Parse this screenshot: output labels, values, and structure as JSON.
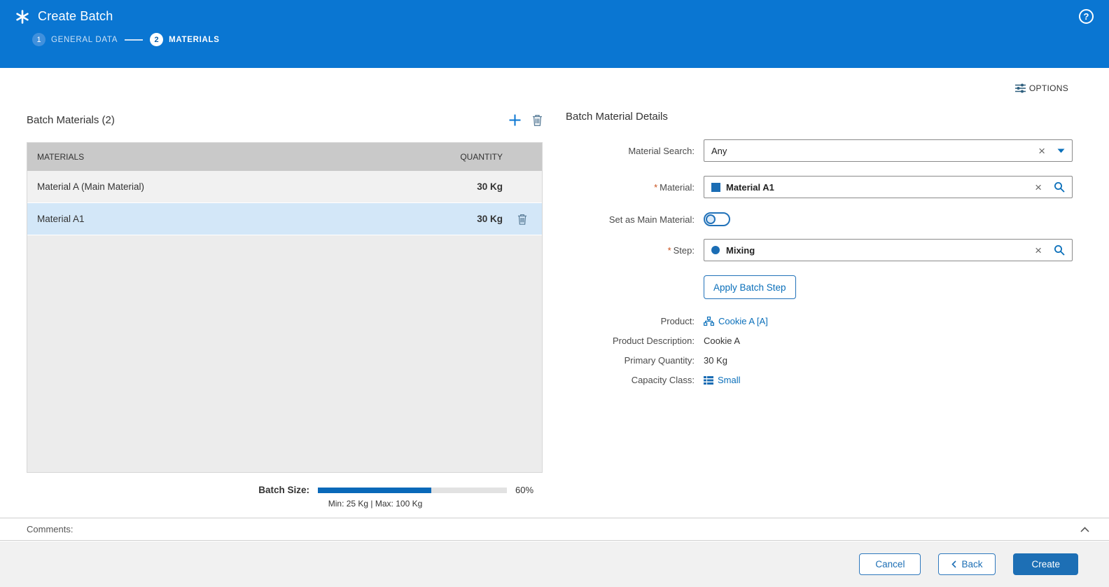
{
  "colors": {
    "header_bg": "#0a76d2",
    "accent": "#0a6fba",
    "selected_row": "#d3e7f8",
    "primary_button": "#1d6fb5",
    "progress_fill": "#0a69b9"
  },
  "icons": {
    "clear": "×",
    "help": "?",
    "required_marker": "*"
  },
  "header": {
    "title": "Create Batch",
    "steps": [
      {
        "number": "1",
        "label": "GENERAL DATA",
        "state": "done"
      },
      {
        "number": "2",
        "label": "MATERIALS",
        "state": "active"
      }
    ]
  },
  "toolbar": {
    "options_label": "OPTIONS"
  },
  "materials_panel": {
    "title": "Batch Materials (2)",
    "columns": {
      "materials": "MATERIALS",
      "quantity": "QUANTITY"
    },
    "rows": [
      {
        "material": "Material A (Main Material)",
        "quantity": "30 Kg",
        "selected": false
      },
      {
        "material": "Material A1",
        "quantity": "30 Kg",
        "selected": true
      }
    ],
    "batch_size": {
      "label": "Batch Size:",
      "value": 60,
      "percent": "60%",
      "range_text": "Min: 25 Kg | Max: 100 Kg"
    }
  },
  "details_panel": {
    "title": "Batch Material Details",
    "material_search_label": "Material Search:",
    "material_search_value": "Any",
    "material_label": "Material:",
    "material_value": "Material A1",
    "set_main_label": "Set as Main Material:",
    "set_main_state": "off",
    "step_label": "Step:",
    "step_value": "Mixing",
    "apply_button_label": "Apply Batch Step",
    "product_label": "Product:",
    "product_value": "Cookie A [A]",
    "product_description_label": "Product Description:",
    "product_description_value": "Cookie A",
    "primary_quantity_label": "Primary Quantity:",
    "primary_quantity_value": "30 Kg",
    "capacity_class_label": "Capacity Class:",
    "capacity_class_value": "Small"
  },
  "comments": {
    "label": "Comments:"
  },
  "footer": {
    "cancel_label": "Cancel",
    "back_label": "Back",
    "create_label": "Create"
  }
}
